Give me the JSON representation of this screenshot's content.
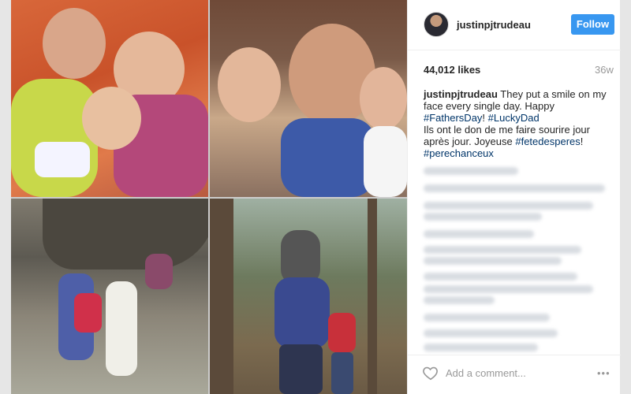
{
  "post": {
    "username": "justinpjtrudeau",
    "follow_label": "Follow",
    "likes": "44,012 likes",
    "age": "36w",
    "caption_user": "justinpjtrudeau",
    "caption_text_1": " They put a smile on my face every single day. Happy ",
    "hashtag_1": "#FathersDay",
    "caption_sep": "! ",
    "hashtag_2": "#LuckyDad",
    "caption_text_2": "Ils ont le don de me faire sourire jour après jour. Joyeuse ",
    "hashtag_3": "#fetedesperes",
    "caption_text_3": "! ",
    "hashtag_4": "#perechanceux"
  },
  "comment_box": {
    "placeholder": "Add a comment...",
    "more_label": "•••"
  },
  "icons": {
    "heart": "heart-icon",
    "more": "more-options-icon"
  },
  "colors": {
    "follow_button": "#3897f0",
    "hashtag": "#003569"
  }
}
